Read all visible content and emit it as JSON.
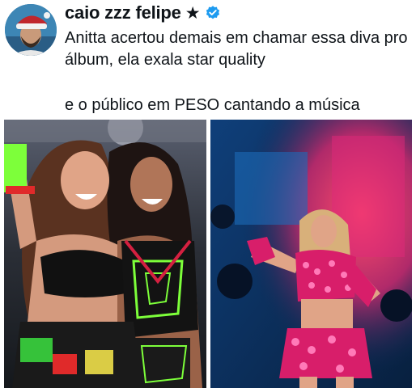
{
  "user": {
    "display_name": "caio zzz felipe",
    "star_glyph": "★",
    "verified_color": "#1d9bf0"
  },
  "tweet": {
    "text": "Anitta acertou demais em chamar essa diva pro álbum, ela exala star quality",
    "text_line2": "e o público em PESO cantando a música"
  },
  "media": [
    {
      "name": "photo-two-singers-hugging"
    },
    {
      "name": "photo-singer-on-stage-pink-outfit"
    }
  ],
  "colors": {
    "text": "#0f1419",
    "neon_green": "#7dff3a",
    "pink_stage": "#e0287a",
    "stage_blue": "#0a2a56"
  }
}
